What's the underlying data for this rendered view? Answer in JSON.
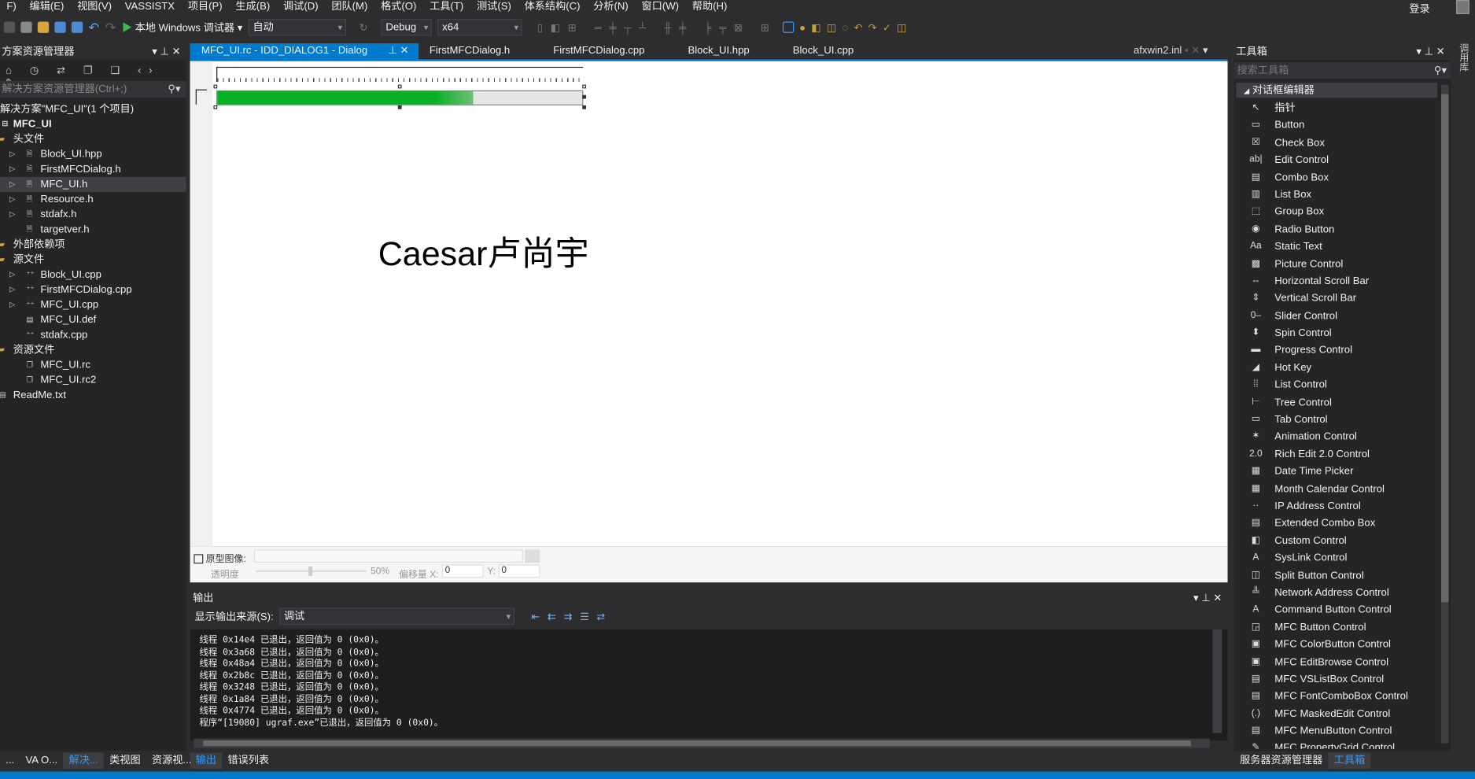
{
  "menu": [
    "F)",
    "编辑(E)",
    "视图(V)",
    "VASSISTX",
    "项目(P)",
    "生成(B)",
    "调试(D)",
    "团队(M)",
    "格式(O)",
    "工具(T)",
    "测试(S)",
    "体系结构(C)",
    "分析(N)",
    "窗口(W)",
    "帮助(H)"
  ],
  "login": "登录",
  "toolbar": {
    "run_label": "本地 Windows 调试器",
    "run_mode": "自动",
    "config": "Debug",
    "platform": "x64"
  },
  "solution_explorer": {
    "title": "方案资源管理器",
    "search_placeholder": "解决方案资源管理器(Ctrl+;)",
    "solution": "解决方案\"MFC_UI\"(1 个项目)",
    "project": "MFC_UI",
    "items": [
      {
        "label": "头文件",
        "level": 1,
        "type": "folder"
      },
      {
        "label": "Block_UI.hpp",
        "level": 2,
        "type": "h",
        "expand": true
      },
      {
        "label": "FirstMFCDialog.h",
        "level": 2,
        "type": "h",
        "expand": true
      },
      {
        "label": "MFC_UI.h",
        "level": 2,
        "type": "h",
        "expand": true,
        "selected": true
      },
      {
        "label": "Resource.h",
        "level": 2,
        "type": "h",
        "expand": true
      },
      {
        "label": "stdafx.h",
        "level": 2,
        "type": "h",
        "expand": true
      },
      {
        "label": "targetver.h",
        "level": 2,
        "type": "h"
      },
      {
        "label": "外部依赖项",
        "level": 1,
        "type": "folder"
      },
      {
        "label": "源文件",
        "level": 1,
        "type": "folder"
      },
      {
        "label": "Block_UI.cpp",
        "level": 2,
        "type": "cpp",
        "expand": true
      },
      {
        "label": "FirstMFCDialog.cpp",
        "level": 2,
        "type": "cpp",
        "expand": true
      },
      {
        "label": "MFC_UI.cpp",
        "level": 2,
        "type": "cpp",
        "expand": true
      },
      {
        "label": "MFC_UI.def",
        "level": 2,
        "type": "file"
      },
      {
        "label": "stdafx.cpp",
        "level": 2,
        "type": "cpp"
      },
      {
        "label": "资源文件",
        "level": 1,
        "type": "folder"
      },
      {
        "label": "MFC_UI.rc",
        "level": 2,
        "type": "rc"
      },
      {
        "label": "MFC_UI.rc2",
        "level": 2,
        "type": "rc"
      },
      {
        "label": "ReadMe.txt",
        "level": 1,
        "type": "file"
      }
    ]
  },
  "doc_tabs": [
    "MFC_UI.rc - IDD_DIALOG1 - Dialog",
    "FirstMFCDialog.h",
    "FirstMFCDialog.cpp",
    "Block_UI.hpp",
    "Block_UI.cpp"
  ],
  "doc_tab_right": "afxwin2.inl",
  "dialog": {
    "static_text": "Caesar卢尚宇",
    "progress_percent": 70,
    "progress_color": "#06b025"
  },
  "editor_bottom": {
    "prototype_label": "原型图像:",
    "opacity_label": "透明度",
    "opacity_value": "50%",
    "offset_label": "偏移量 X:",
    "x_value": "0",
    "y_label": "Y:",
    "y_value": "0"
  },
  "output": {
    "title": "输出",
    "source_label": "显示输出来源(S):",
    "source_value": "调试",
    "lines": [
      "线程 0x14e4 已退出，返回值为 0 (0x0)。",
      "线程 0x3a68 已退出，返回值为 0 (0x0)。",
      "线程 0x48a4 已退出，返回值为 0 (0x0)。",
      "线程 0x2b8c 已退出，返回值为 0 (0x0)。",
      "线程 0x3248 已退出，返回值为 0 (0x0)。",
      "线程 0x1a84 已退出，返回值为 0 (0x0)。",
      "线程 0x4774 已退出，返回值为 0 (0x0)。",
      "程序“[19080] ugraf.exe”已退出，返回值为 0 (0x0)。"
    ]
  },
  "bottom_tabs_left": [
    "...",
    "VA O...",
    "解决...",
    "类视图",
    "资源视..."
  ],
  "bottom_tabs_output": [
    "输出",
    "错误列表"
  ],
  "toolbox": {
    "title": "工具箱",
    "search_placeholder": "搜索工具箱",
    "category": "对话框编辑器",
    "items": [
      [
        "指针",
        "↖"
      ],
      [
        "Button",
        "▭"
      ],
      [
        "Check Box",
        "☒"
      ],
      [
        "Edit Control",
        "ab|"
      ],
      [
        "Combo Box",
        "▤"
      ],
      [
        "List Box",
        "▥"
      ],
      [
        "Group Box",
        "⬚"
      ],
      [
        "Radio Button",
        "◉"
      ],
      [
        "Static Text",
        "Aa"
      ],
      [
        "Picture Control",
        "▩"
      ],
      [
        "Horizontal Scroll Bar",
        "⇔"
      ],
      [
        "Vertical Scroll Bar",
        "⇕"
      ],
      [
        "Slider Control",
        "0–"
      ],
      [
        "Spin Control",
        "⬍"
      ],
      [
        "Progress Control",
        "▬"
      ],
      [
        "Hot Key",
        "◢"
      ],
      [
        "List Control",
        "⁞⁞"
      ],
      [
        "Tree Control",
        "⊢"
      ],
      [
        "Tab Control",
        "▭"
      ],
      [
        "Animation Control",
        "✶"
      ],
      [
        "Rich Edit 2.0 Control",
        "2.0"
      ],
      [
        "Date Time Picker",
        "▦"
      ],
      [
        "Month Calendar Control",
        "▦"
      ],
      [
        "IP Address Control",
        "··"
      ],
      [
        "Extended Combo Box",
        "▤"
      ],
      [
        "Custom Control",
        "◧"
      ],
      [
        "SysLink Control",
        "A"
      ],
      [
        "Split Button Control",
        "◫"
      ],
      [
        "Network Address Control",
        "╩"
      ],
      [
        "Command Button Control",
        "A"
      ],
      [
        "MFC Button Control",
        "◲"
      ],
      [
        "MFC ColorButton Control",
        "▣"
      ],
      [
        "MFC EditBrowse Control",
        "▣"
      ],
      [
        "MFC VSListBox Control",
        "▤"
      ],
      [
        "MFC FontComboBox Control",
        "▤"
      ],
      [
        "MFC MaskedEdit Control",
        "(.)"
      ],
      [
        "MFC MenuButton Control",
        "▤"
      ],
      [
        "MFC PropertyGrid Control",
        "✎"
      ]
    ]
  },
  "bottom_tabs_right": [
    "服务器资源管理器",
    "工具箱"
  ],
  "side_strip": "调用库",
  "colors": {
    "accent": "#007acc",
    "bg": "#2d2d30",
    "panel": "#252526"
  }
}
